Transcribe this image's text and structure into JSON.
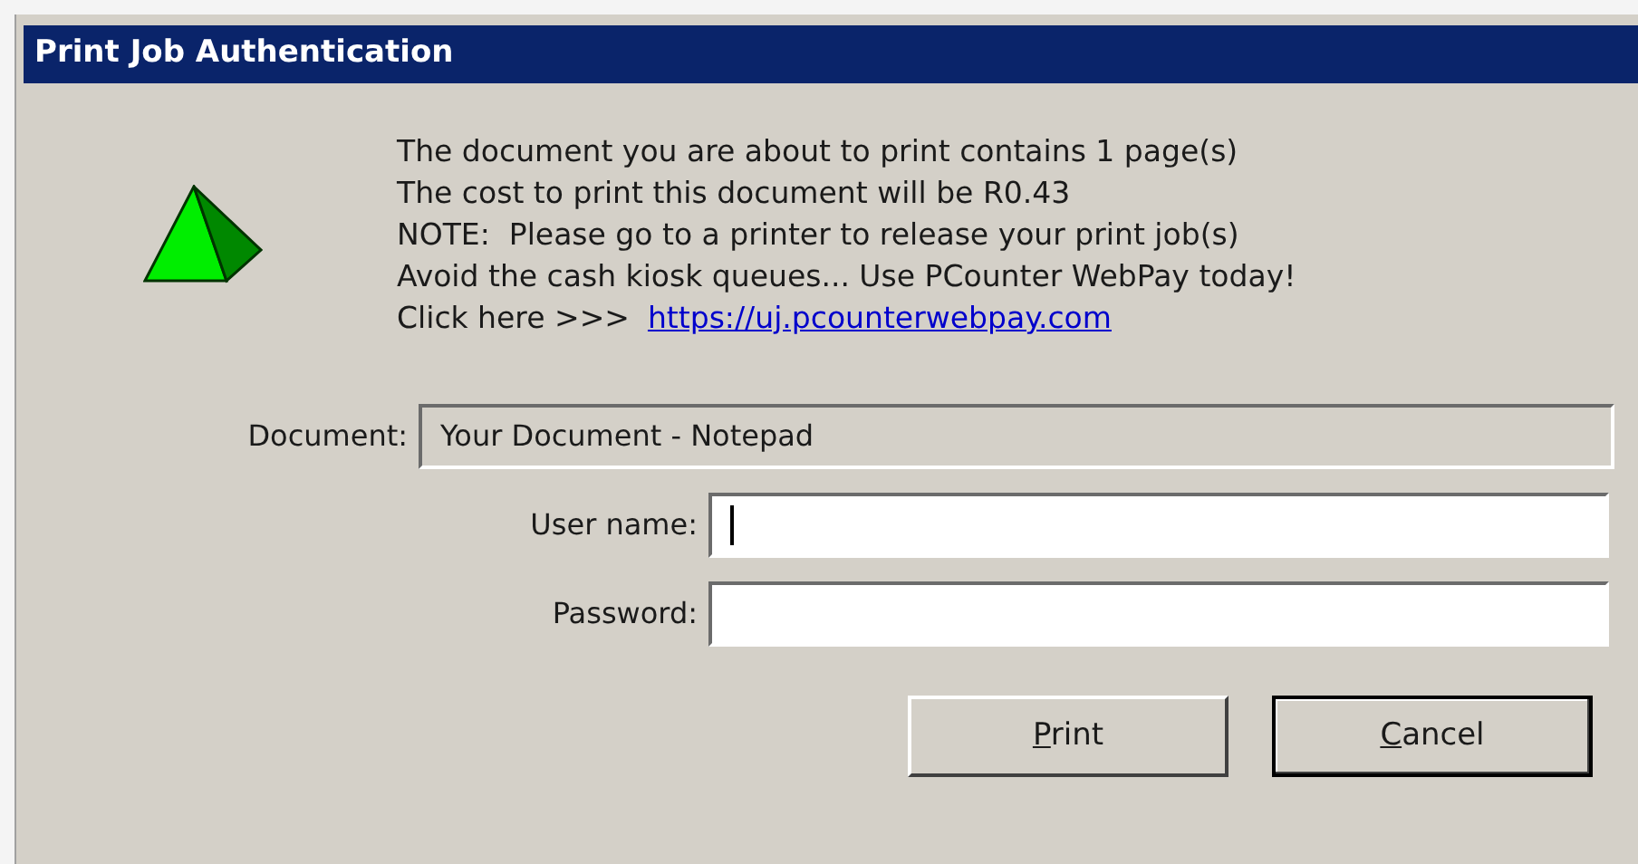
{
  "window": {
    "title": "Print Job Authentication"
  },
  "message": {
    "lines": [
      "The document you are about to print contains 1 page(s)",
      "The cost to print this document will be R0.43",
      "NOTE:  Please go to a printer to release your print job(s)",
      "Avoid the cash kiosk queues... Use PCounter WebPay today!"
    ],
    "link_prefix": "Click here >>>",
    "link": "https://uj.pcounterwebpay.com"
  },
  "fields": [
    {
      "label": "Document:",
      "value": "Your Document - Notepad",
      "disabled": true
    },
    {
      "label": "User name:",
      "disabled": false,
      "focused": true
    },
    {
      "label": "Password:",
      "disabled": false
    }
  ],
  "buttons": [
    {
      "label": "Print",
      "default": false
    },
    {
      "label": "Cancel",
      "default": true
    }
  ]
}
